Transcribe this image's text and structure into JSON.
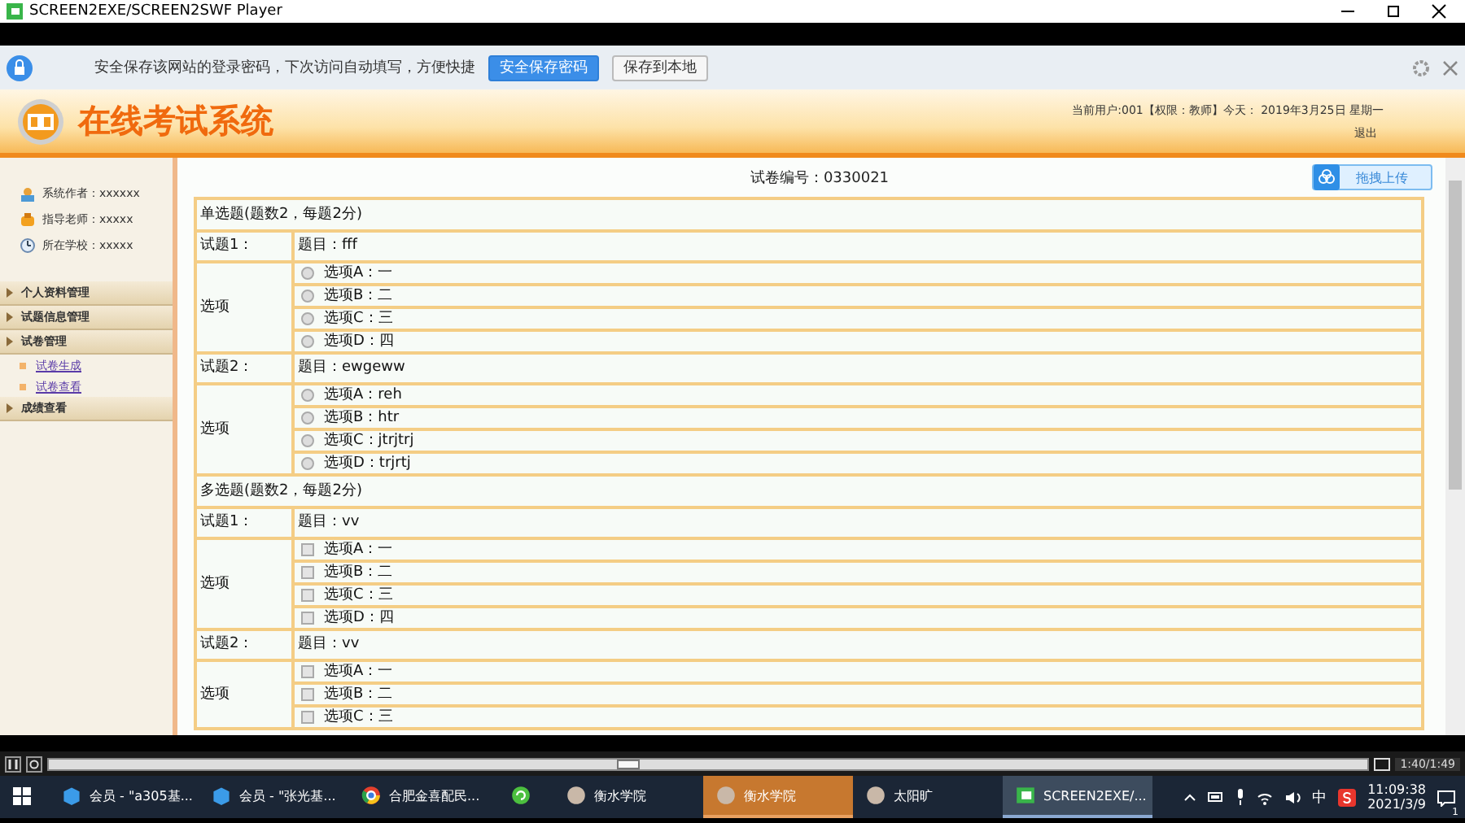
{
  "player_window": {
    "title": "SCREEN2EXE/SCREEN2SWF Player"
  },
  "password_bar": {
    "message": "安全保存该网站的登录密码，下次访问自动填写，方便快捷",
    "buttons": [
      {
        "label": "安全保存密码",
        "primary": true
      },
      {
        "label": "保存到本地",
        "primary": false
      }
    ]
  },
  "header": {
    "title": "在线考试系统",
    "user_info": "当前用户:001【权限：教师】今天： 2019年3月25日 星期一",
    "logout": "退出"
  },
  "sidebar": {
    "info": [
      {
        "kind": "author",
        "label": "系统作者：xxxxxx"
      },
      {
        "kind": "teacher",
        "label": "指导老师：xxxxx"
      },
      {
        "kind": "school",
        "label": "所在学校：xxxxx"
      }
    ],
    "menu": [
      {
        "label": "个人资料管理"
      },
      {
        "label": "试题信息管理"
      },
      {
        "label": "试卷管理",
        "children": [
          {
            "label": "试卷生成"
          },
          {
            "label": "试卷查看"
          }
        ]
      },
      {
        "label": "成绩查看"
      }
    ]
  },
  "exam": {
    "paper_no": "试卷编号：0330021",
    "upload_button": "拖拽上传",
    "sections": [
      {
        "kind": "single",
        "title": "单选题(题数2，每题2分)",
        "questions": [
          {
            "number": "试题1：",
            "stem": "题目：fff",
            "options_label": "选项",
            "options": [
              {
                "text": "选项A：一",
                "checked": false
              },
              {
                "text": "选项B：二",
                "checked": false
              },
              {
                "text": "选项C：三",
                "checked": false
              },
              {
                "text": "选项D：四",
                "checked": false
              }
            ]
          },
          {
            "number": "试题2：",
            "stem": "题目：ewgeww",
            "options_label": "选项",
            "options": [
              {
                "text": "选项A：reh",
                "checked": false
              },
              {
                "text": "选项B：htr",
                "checked": false
              },
              {
                "text": "选项C：jtrjtrj",
                "checked": false
              },
              {
                "text": "选项D：trjrtj",
                "checked": false
              }
            ]
          }
        ]
      },
      {
        "kind": "multiple",
        "title": "多选题(题数2，每题2分)",
        "questions": [
          {
            "number": "试题1：",
            "stem": "题目：vv",
            "options_label": "选项",
            "options": [
              {
                "text": "选项A：一",
                "checked": false
              },
              {
                "text": "选项B：二",
                "checked": false
              },
              {
                "text": "选项C：三",
                "checked": false
              },
              {
                "text": "选项D：四",
                "checked": false
              }
            ]
          },
          {
            "number": "试题2：",
            "stem": "题目：vv",
            "options_label": "选项",
            "options": [
              {
                "text": "选项A：一",
                "checked": false
              },
              {
                "text": "选项B：二",
                "checked": false
              },
              {
                "text": "选项C：三",
                "checked": false
              }
            ]
          }
        ]
      }
    ]
  },
  "player": {
    "level": 0.44,
    "time": "1:40/1:49"
  },
  "taskbar": {
    "items": [
      {
        "kind": "cube",
        "label": "会员 - \"a305基...",
        "selected": false,
        "flashing": false
      },
      {
        "kind": "cube",
        "label": "会员 - \"张光基...",
        "selected": false,
        "flashing": false
      },
      {
        "kind": "chrome",
        "label": "合肥金喜配民...",
        "selected": false,
        "flashing": false
      },
      {
        "kind": "green",
        "selected": false,
        "flashing": false
      },
      {
        "kind": "avatar",
        "label": "衡水学院",
        "selected": false,
        "flashing": false
      },
      {
        "kind": "avatar",
        "label": "衡水学院",
        "selected": false,
        "flashing": true
      },
      {
        "kind": "avatar",
        "label": "太阳旷",
        "selected": false,
        "flashing": false
      },
      {
        "kind": "screen",
        "label": "SCREEN2EXE/...",
        "selected": true,
        "flashing": false
      }
    ],
    "tray": {
      "ime": "中",
      "time": "11:09:38",
      "date": "2021/3/9",
      "notifications": "1"
    }
  }
}
